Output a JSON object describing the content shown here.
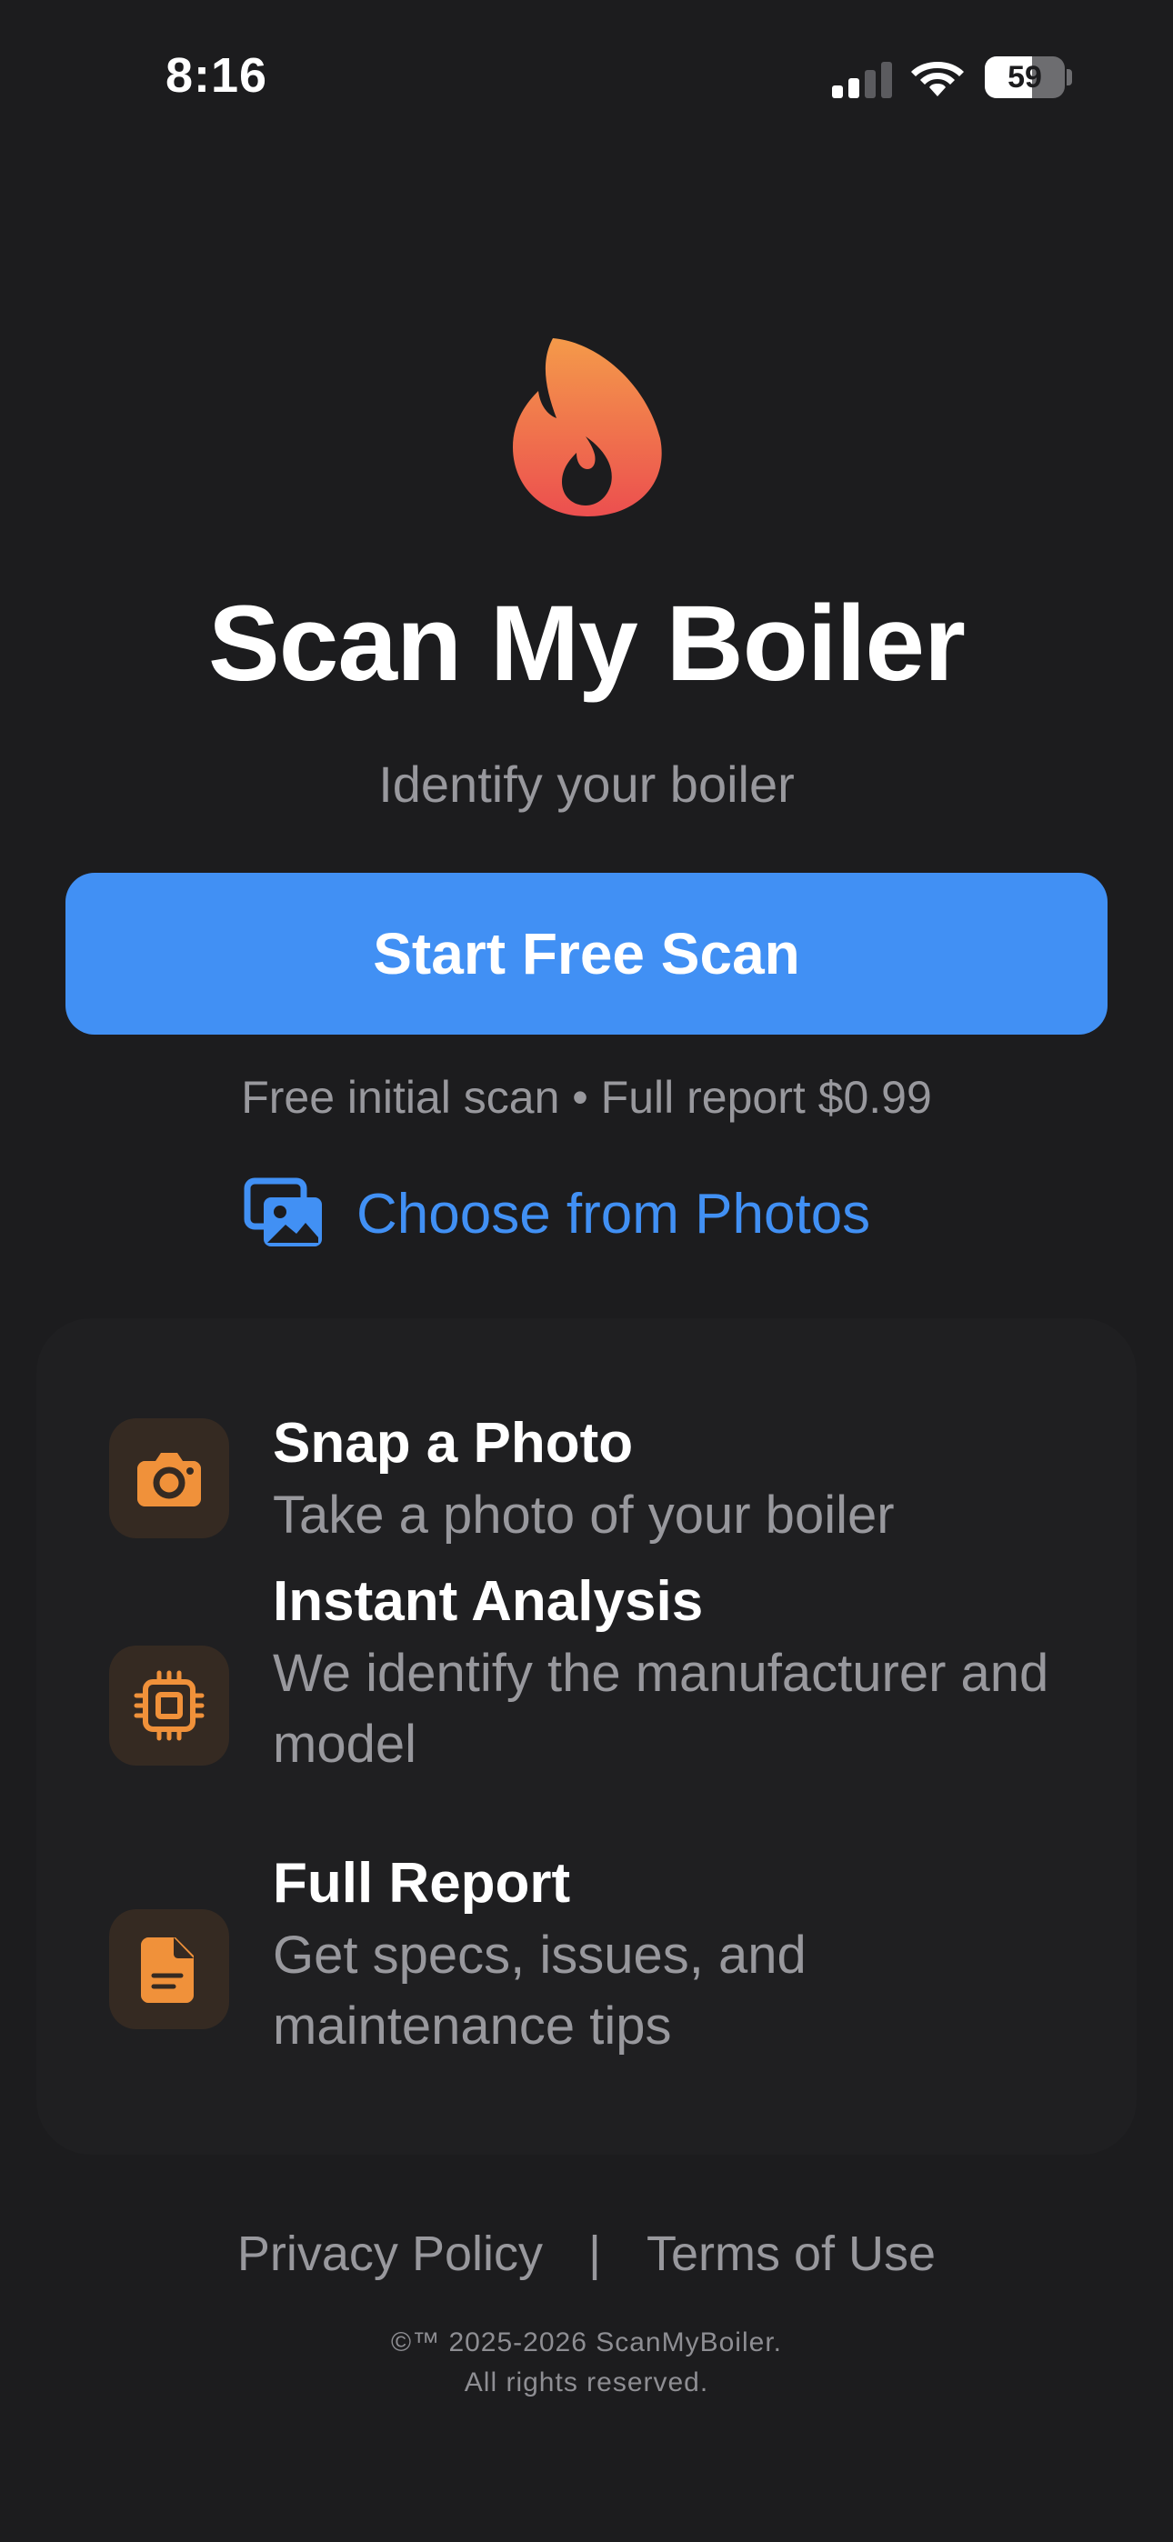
{
  "status_bar": {
    "time": "8:16",
    "battery_level": "59",
    "battery_fraction": 0.59,
    "signal_bars_active": 2,
    "signal_bars_total": 4
  },
  "hero": {
    "icon": "flame-icon",
    "title": "Scan My Boiler",
    "subtitle": "Identify your boiler",
    "primary_button": "Start Free Scan",
    "pricing_note": "Free initial scan • Full report $0.99",
    "photos_link": "Choose from Photos",
    "photos_icon": "photo-library-icon"
  },
  "features": [
    {
      "icon": "camera-icon",
      "title": "Snap a Photo",
      "description": "Take a photo of your boiler"
    },
    {
      "icon": "cpu-chip-icon",
      "title": "Instant Analysis",
      "description": "We identify the manufacturer and model"
    },
    {
      "icon": "document-icon",
      "title": "Full Report",
      "description": "Get specs, issues, and maintenance tips"
    }
  ],
  "footer": {
    "privacy": "Privacy Policy",
    "separator": "|",
    "terms": "Terms of Use",
    "copyright_line1": "©™ 2025-2026 ScanMyBoiler.",
    "copyright_line2": "All rights reserved."
  },
  "colors": {
    "background": "#1c1c1e",
    "card": "#1f1f21",
    "accent_blue": "#4190f4",
    "accent_orange": "#f0913a",
    "flame_top": "#f49a4a",
    "flame_bottom": "#ec4f4f",
    "secondary_text": "#98989d"
  }
}
